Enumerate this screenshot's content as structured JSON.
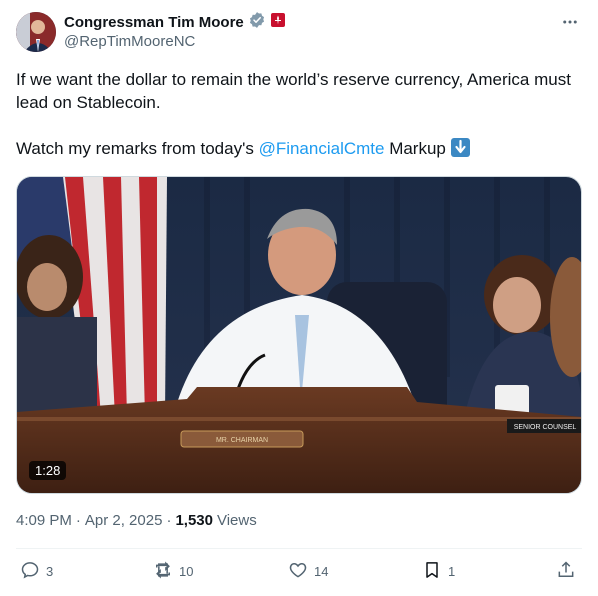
{
  "author": {
    "name": "Congressman Tim Moore",
    "handle": "@RepTimMooreNC"
  },
  "post": {
    "line1": "If we want the dollar to remain the world’s reserve currency, America must lead on Stablecoin.",
    "line2_prefix": "Watch my remarks from today's ",
    "mention": "@FinancialCmte",
    "line2_suffix": " Markup "
  },
  "media": {
    "duration": "1:28",
    "nameplate_left": "MR. CHAIRMAN",
    "nameplate_right": "SENIOR COUNSEL"
  },
  "meta": {
    "time": "4:09 PM",
    "sep1": "·",
    "date": "Apr 2, 2025",
    "sep2": "·",
    "views_count": "1,530",
    "views_label": "Views"
  },
  "actions": {
    "replies": "3",
    "reposts": "10",
    "likes": "14",
    "bookmarks": "1"
  },
  "colors": {
    "accent": "#1d9bf0",
    "secondary_text": "#536471",
    "primary_text": "#0f1419"
  }
}
